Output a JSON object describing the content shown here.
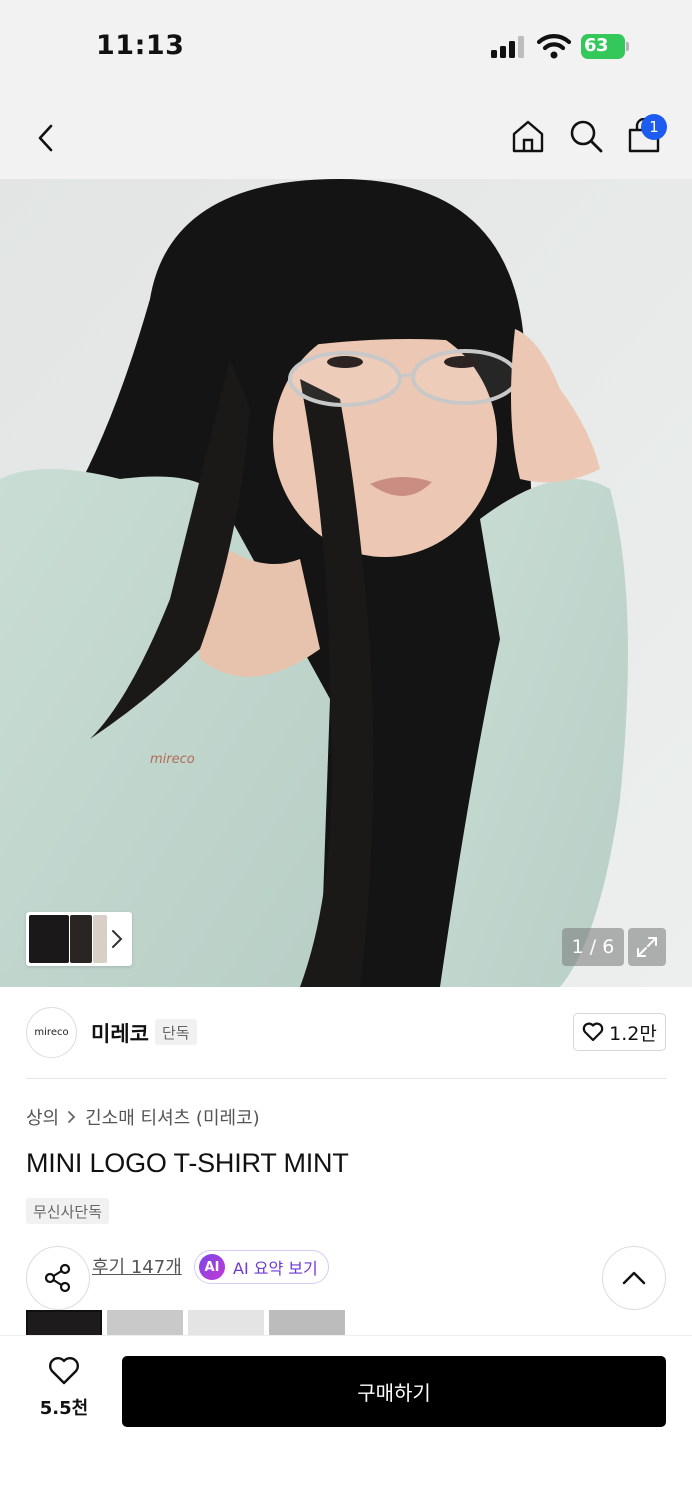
{
  "status_bar": {
    "time": "11:13",
    "battery": "63"
  },
  "nav": {
    "cart_count": "1",
    "icons": [
      "chevron-left-icon",
      "home-icon",
      "search-icon",
      "shopping-bag-icon"
    ]
  },
  "hero": {
    "page_indicator": "1 / 6",
    "logo_text": "mireco"
  },
  "brand": {
    "logo_text": "mireco",
    "name": "미레코",
    "tag": "단독",
    "likes": "1.2만"
  },
  "breadcrumb": {
    "level1": "상의",
    "level2": "긴소매 티셔츠 (미레코)"
  },
  "product": {
    "title": "MINI LOGO T-SHIRT MINT",
    "exclusive_tag": "무신사단독"
  },
  "reviews": {
    "link": "후기 147개",
    "ai_badge": "AI",
    "ai_button": "AI 요약 보기"
  },
  "bottom_bar": {
    "wish_count": "5.5천",
    "buy_label": "구매하기"
  },
  "colors": {
    "accent": "#1e5bf0",
    "battery": "#34c759",
    "shirt": "#c3d8cf",
    "ai": "#6e3ad6"
  }
}
